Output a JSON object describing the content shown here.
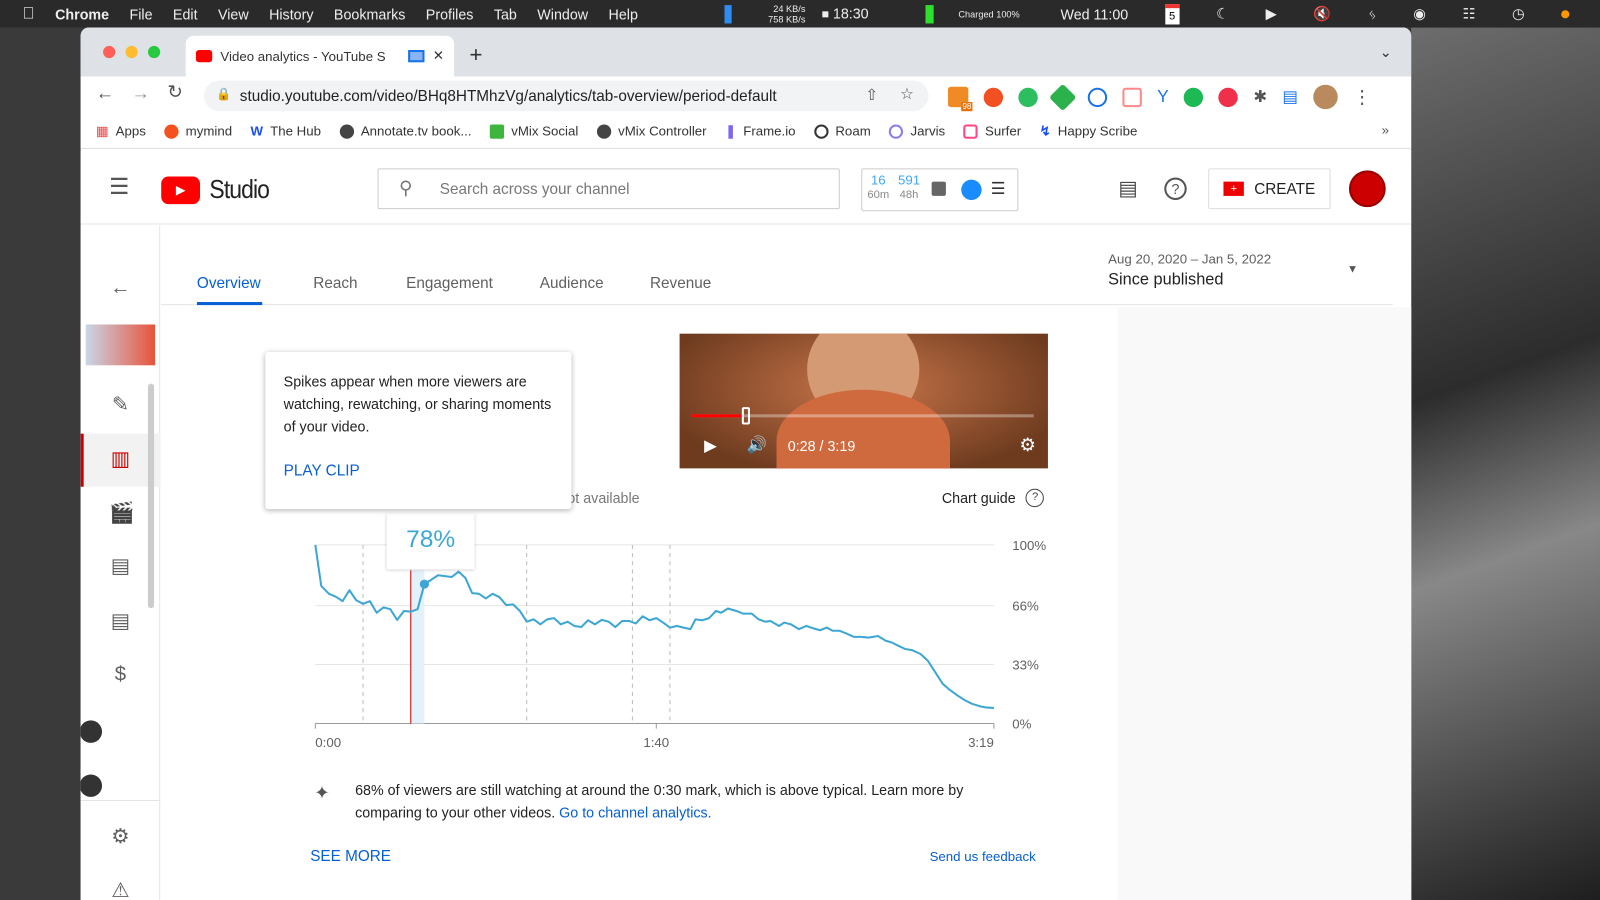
{
  "menubar": {
    "app": "Chrome",
    "items": [
      "File",
      "Edit",
      "View",
      "History",
      "Bookmarks",
      "Profiles",
      "Tab",
      "Window",
      "Help"
    ],
    "net_up": "24 KB/s",
    "net_down": "758 KB/s",
    "timer": "18:30",
    "battery": "Charged 100%",
    "clock": "Wed 11:00",
    "calendar_day": "5"
  },
  "browser": {
    "tab_title": "Video analytics - YouTube S",
    "url": "studio.youtube.com/video/BHq8HTMhzVg/analytics/tab-overview/period-default",
    "extension_badge": "98",
    "bookmarks": [
      "Apps",
      "mymind",
      "The Hub",
      "Annotate.tv book...",
      "vMix Social",
      "vMix Controller",
      "Frame.io",
      "Roam",
      "Jarvis",
      "Surfer",
      "Happy Scribe"
    ]
  },
  "studio": {
    "logo": "Studio",
    "search_placeholder": "Search across your channel",
    "vidiq": {
      "a": "16",
      "a_label": "60m",
      "b": "591",
      "b_label": "48h"
    },
    "create": "CREATE"
  },
  "tabs": [
    "Overview",
    "Reach",
    "Engagement",
    "Audience",
    "Revenue"
  ],
  "date": {
    "range": "Aug 20, 2020 – Jan 5, 2022",
    "label": "Since published"
  },
  "popup": {
    "text": "Spikes appear when more viewers are watching, rewatching, or sharing moments of your video.",
    "action": "PLAY CLIP"
  },
  "player": {
    "time": "0:28 / 3:19",
    "progress": 0.146
  },
  "chart_header": {
    "hidden_text": "ot available",
    "guide": "Chart guide"
  },
  "tooltip": {
    "value": "78%"
  },
  "chart_data": {
    "type": "line",
    "xlim": [
      0,
      199
    ],
    "ylim": [
      0,
      100
    ],
    "xticks": [
      "0:00",
      "1:40",
      "3:19"
    ],
    "xtick_values": [
      0,
      100,
      199
    ],
    "yticks": [
      "100%",
      "66%",
      "33%",
      "0%"
    ],
    "ytick_values": [
      100,
      66,
      33,
      0
    ],
    "current_time_s": 28,
    "key_moments_s": [
      14,
      62,
      93,
      104
    ],
    "series_color": "#3ea6d3",
    "x": [
      0,
      1.75,
      4,
      6,
      8,
      10,
      12,
      14,
      16,
      18,
      20,
      22,
      24,
      26,
      28,
      30,
      32,
      36,
      40,
      42,
      44,
      46,
      48,
      50,
      52,
      54,
      56,
      58,
      60,
      62,
      64,
      66,
      68,
      70,
      72,
      74,
      76,
      78,
      80,
      82,
      84,
      86,
      88,
      90,
      92,
      94,
      96,
      98,
      100,
      102,
      104,
      106,
      108,
      110,
      111.5,
      113.5,
      115.5,
      117.5,
      119,
      121,
      123.5,
      125.5,
      128,
      130,
      132,
      133.5,
      136,
      137.5,
      139.5,
      141.8,
      144,
      146,
      148,
      150,
      151.7,
      153.8,
      155.7,
      157.9,
      160,
      162.3,
      165,
      167.3,
      169,
      171,
      173,
      175,
      177.5,
      179.6,
      181.8,
      184,
      186,
      188.3,
      190.5,
      192.6,
      195,
      197,
      199
    ],
    "y": [
      100,
      77,
      72.6,
      71,
      68.5,
      74.6,
      69,
      67,
      68.5,
      62,
      65,
      64,
      58,
      63,
      62.6,
      64,
      78,
      83,
      82,
      85,
      81.5,
      73,
      72.6,
      70,
      72.6,
      70.7,
      66.3,
      66.7,
      63,
      57,
      58.3,
      55.5,
      58.3,
      59,
      55.5,
      57,
      54.6,
      54,
      57.8,
      55.5,
      58,
      57,
      54,
      57.4,
      57.4,
      56,
      60,
      57.8,
      59,
      56.5,
      53.7,
      54.6,
      53.7,
      52.8,
      58.3,
      57.8,
      59,
      63,
      62,
      64.4,
      63,
      61.5,
      61.5,
      58.3,
      57,
      57.4,
      54.6,
      56.5,
      55.5,
      52.8,
      54.6,
      53.3,
      52.2,
      53.7,
      51.9,
      51.9,
      50.4,
      48.5,
      48.5,
      48.1,
      49,
      46.3,
      45.4,
      43.5,
      41.7,
      41.1,
      38.9,
      35.2,
      28.7,
      22.2,
      18.9,
      15.7,
      13,
      11,
      9.6,
      8.9,
      8.7
    ]
  },
  "insight": {
    "text": "68% of viewers are still watching at around the 0:30 mark, which is above typical. Learn more by comparing to your other videos.",
    "link": "Go to channel analytics."
  },
  "footer": {
    "see_more": "SEE MORE",
    "feedback": "Send us feedback"
  }
}
